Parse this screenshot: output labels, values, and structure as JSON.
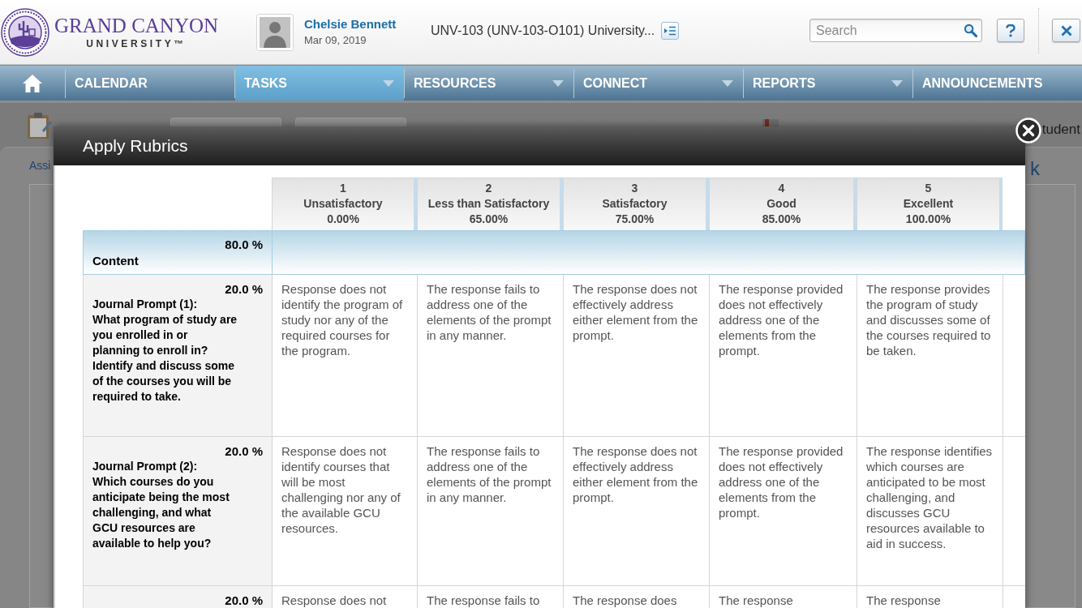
{
  "header": {
    "logo": {
      "name": "GRAND CANYON",
      "subtitle": "UNIVERSITY™"
    },
    "user": {
      "name": "Chelsie Bennett",
      "date": "Mar 09, 2019"
    },
    "course_title": "UNV-103 (UNV-103-O101) University...",
    "search": {
      "placeholder": "Search"
    }
  },
  "nav": {
    "items": [
      {
        "label": "CALENDAR",
        "selected": false,
        "has_menu": false
      },
      {
        "label": "TASKS",
        "selected": true,
        "has_menu": true
      },
      {
        "label": "RESOURCES",
        "selected": false,
        "has_menu": true
      },
      {
        "label": "CONNECT",
        "selected": false,
        "has_menu": true
      },
      {
        "label": "REPORTS",
        "selected": false,
        "has_menu": true
      },
      {
        "label": "ANNOUNCEMENTS",
        "selected": false,
        "has_menu": false
      }
    ]
  },
  "background": {
    "link_fragment": "Assi",
    "heading_fragment": "tudent",
    "side_fragment": "k"
  },
  "dialog": {
    "title": "Apply Rubrics",
    "levels": [
      {
        "number": "1",
        "label": "Unsatisfactory",
        "percent": "0.00%"
      },
      {
        "number": "2",
        "label": "Less than Satisfactory",
        "percent": "65.00%"
      },
      {
        "number": "3",
        "label": "Satisfactory",
        "percent": "75.00%"
      },
      {
        "number": "4",
        "label": "Good",
        "percent": "85.00%"
      },
      {
        "number": "5",
        "label": "Excellent",
        "percent": "100.00%"
      }
    ],
    "rows": [
      {
        "kind": "group",
        "weight": "80.0 %",
        "name": "Content"
      },
      {
        "kind": "criterion",
        "weight": "20.0 %",
        "name": "Journal Prompt (1):",
        "question": "What program of study are you enrolled in or planning to enroll in? Identify and discuss some of the courses you will be required to take.",
        "cells": [
          "Response does not identify the program of study nor any of the required courses for the program.",
          "The response fails to address one of the elements of the prompt in any manner.",
          "The response does not effectively address either element from the prompt.",
          "The response provided does not effectively address one of the elements from the prompt.",
          "The response provides the program of study and discusses some of the courses required to be taken."
        ]
      },
      {
        "kind": "criterion",
        "weight": "20.0 %",
        "name": "Journal Prompt (2):",
        "question": "Which courses do you anticipate being the most challenging, and what GCU resources are available to help you?",
        "cells": [
          "Response does not identify courses that will be most challenging nor any of the available GCU resources.",
          "The response fails to address one of the elements of the prompt in any manner.",
          "The response does not effectively address either element from the prompt.",
          "The response provided does not effectively address one of the elements from the prompt.",
          "The response identifies which courses are anticipated to be most challenging, and discusses GCU resources available to aid in success."
        ]
      },
      {
        "kind": "criterion",
        "weight": "20.0 %",
        "cells": [
          "Response does not",
          "The response fails to",
          "The response does",
          "The response",
          "The response"
        ]
      }
    ]
  }
}
